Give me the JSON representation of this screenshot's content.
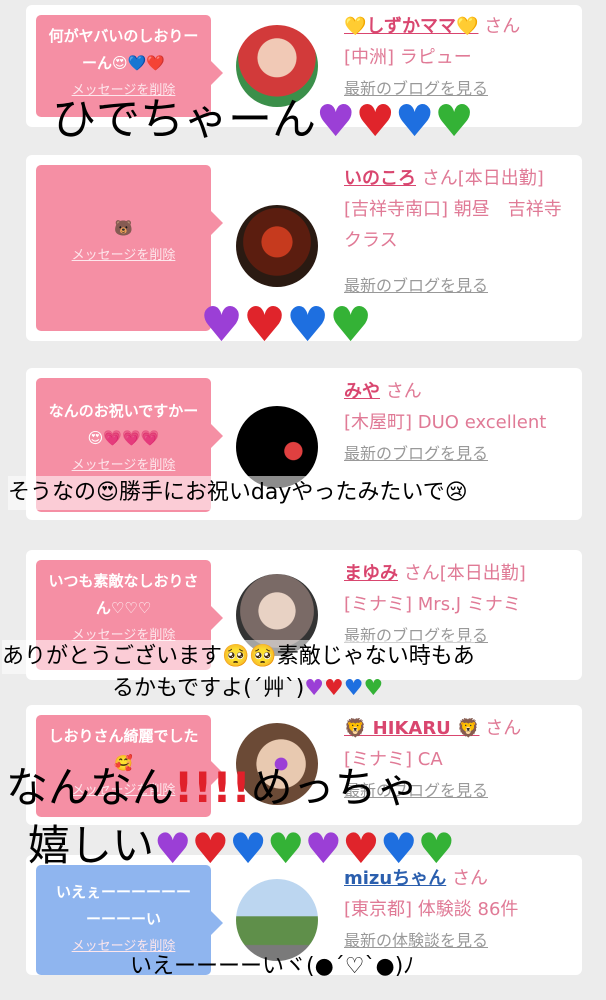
{
  "cards": [
    {
      "message": "何がヤバいのしおりーーん😍💙❤️",
      "delete": "メッセージを削除",
      "name": "💛しずかママ💛",
      "san": "さん",
      "shop": "[中洲] ラピュー",
      "blog": "最新のブログを見る"
    },
    {
      "message": "🐻",
      "delete": "メッセージを削除",
      "name": "いのころ",
      "san": "さん[本日出勤]",
      "shop": "[吉祥寺南口] 朝昼　吉祥寺クラス",
      "blog": "最新のブログを見る"
    },
    {
      "message": "なんのお祝いですかー😍💗💗💗",
      "delete": "メッセージを削除",
      "name": "みや",
      "san": "さん",
      "shop": "[木屋町] DUO excellent",
      "blog": "最新のブログを見る"
    },
    {
      "message": "いつも素敵なしおりさん♡♡♡",
      "delete": "メッセージを削除",
      "name": "まゆみ",
      "san": "さん[本日出勤]",
      "shop": "[ミナミ] Mrs.J ミナミ",
      "blog": "最新のブログを見る"
    },
    {
      "message": "しおりさん綺麗でした🥰",
      "delete": "メッセージを削除",
      "name": "🦁 HIKARU 🦁",
      "san": "さん",
      "shop": "[ミナミ] CA",
      "blog": "最新のブログを見る"
    },
    {
      "message": "いえぇーーーーーーーーーーい",
      "delete": "メッセージを削除",
      "name": "mizuちゃん",
      "san": "さん",
      "shop": "[東京都] 体験談 86件",
      "blog": "最新の体験談を見る"
    }
  ],
  "overlays": {
    "t1": "ひでちゃーん",
    "t2": "そうなの😍勝手にお祝いdayやったみたいで😢",
    "t3a": "ありがとうございます🥺🥺素敵じゃない時もあ",
    "t3b": "るかもですよ(´艸`)",
    "t4a": "なんなん",
    "t4b": "めっちゃ",
    "t4c": "嬉しい",
    "t5": "いえーーーーいヾ(●´♡`●)ﾉ"
  },
  "colors": {
    "purple": "#9b3fd6",
    "red": "#e0242b",
    "blue": "#1e6fe0",
    "green": "#34b236",
    "mark": "#e0202a"
  }
}
